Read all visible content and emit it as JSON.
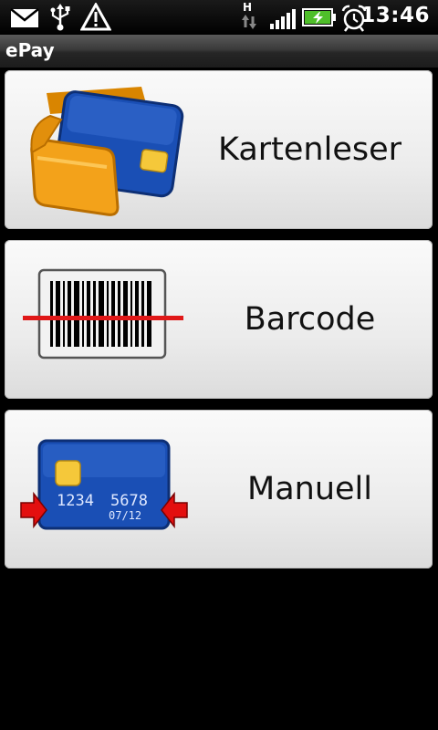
{
  "status_bar": {
    "network_type": "H",
    "time": "13:46"
  },
  "app": {
    "title": "ePay"
  },
  "menu": {
    "items": [
      {
        "label": "Kartenleser",
        "icon": "wallet-card-icon"
      },
      {
        "label": "Barcode",
        "icon": "barcode-scan-icon"
      },
      {
        "label": "Manuell",
        "icon": "manual-card-entry-icon"
      }
    ]
  },
  "card_graphic": {
    "number_a": "1234",
    "number_b": "5678",
    "expiry": "07/12"
  },
  "colors": {
    "card_blue": "#1a4fb5",
    "wallet_orange": "#f3a21a",
    "chip_gold": "#f5c83a",
    "scan_red": "#e01818",
    "arrow_red": "#e30f0f"
  }
}
